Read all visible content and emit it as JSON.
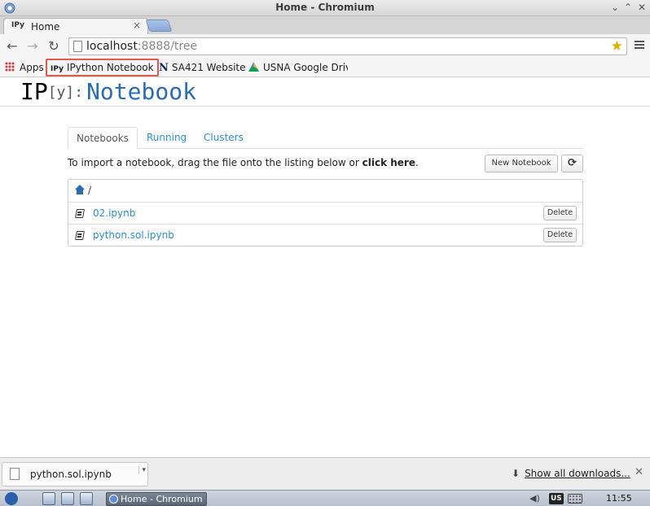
{
  "window": {
    "title": "Home - Chromium"
  },
  "browser": {
    "tab_title": "Home",
    "tab_favicon": "IPy",
    "url_host": "localhost",
    "url_path": ":8888/tree"
  },
  "bookmarks": [
    {
      "label": "Apps",
      "icon": "apps-grid-icon"
    },
    {
      "label": "IPython Notebook",
      "icon": "ipython-icon",
      "prefix": "IPy"
    },
    {
      "label": "SA421 Website",
      "icon": "n-logo-icon",
      "prefix": "N"
    },
    {
      "label": "USNA Google Drive",
      "icon": "google-drive-icon"
    }
  ],
  "page": {
    "logo_ip": "IP",
    "logo_bracket": "[y]:",
    "logo_notebook": "Notebook",
    "tabs": [
      "Notebooks",
      "Running",
      "Clusters"
    ],
    "import_text_pre": "To import a notebook, drag the file onto the listing below or ",
    "import_text_link": "click here",
    "import_text_post": ".",
    "new_notebook_label": "New Notebook",
    "breadcrumb_sep": "/",
    "files": [
      {
        "name": "02.ipynb",
        "delete_label": "Delete"
      },
      {
        "name": "python.sol.ipynb",
        "delete_label": "Delete"
      }
    ]
  },
  "download_shelf": {
    "file_name": "python.sol.ipynb",
    "show_all_label": "Show all downloads..."
  },
  "taskbar": {
    "task_label": "Home - Chromium",
    "keyboard_layout": "US",
    "clock": "11:55"
  },
  "colors": {
    "link": "#2a8ed8",
    "logo_blue": "#2a6cb4",
    "highlight_border": "#e05a4e"
  }
}
